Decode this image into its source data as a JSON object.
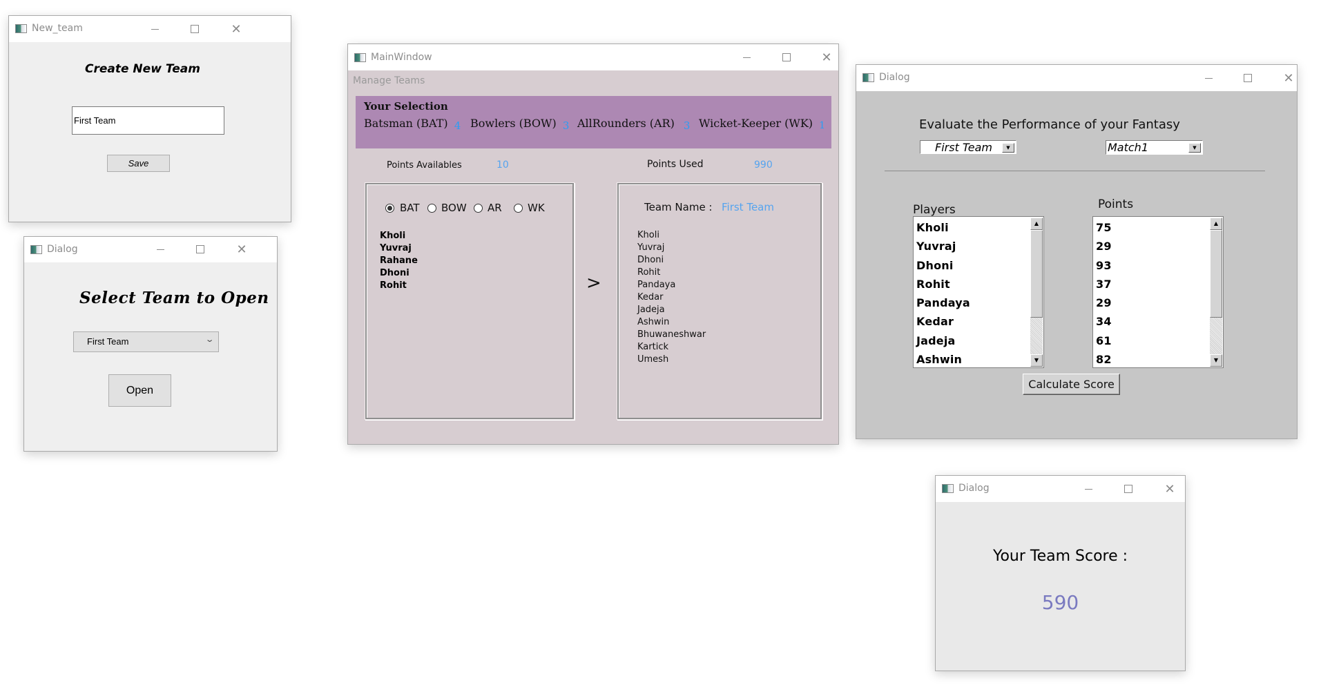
{
  "windows": {
    "new_team": {
      "title": "New_team",
      "heading": "Create New Team",
      "team_name_value": "First Team",
      "save_label": "Save"
    },
    "open_team": {
      "title": "Dialog",
      "heading": "Select Team  to Open",
      "team_select_value": "First Team",
      "open_label": "Open"
    },
    "main": {
      "title": "MainWindow",
      "menu": [
        "Manage Teams"
      ],
      "selection": {
        "heading": "Your Selection",
        "categories": [
          {
            "label": "Batsman (BAT)",
            "count": "4"
          },
          {
            "label": "Bowlers (BOW)",
            "count": "3"
          },
          {
            "label": "AllRounders (AR)",
            "count": "3"
          },
          {
            "label": "Wicket-Keeper (WK)",
            "count": "1"
          }
        ]
      },
      "points_available_label": "Points Availables",
      "points_available_value": "10",
      "points_used_label": "Points Used",
      "points_used_value": "990",
      "roles": [
        {
          "label": "BAT",
          "checked": true
        },
        {
          "label": "BOW",
          "checked": false
        },
        {
          "label": "AR",
          "checked": false
        },
        {
          "label": "WK",
          "checked": false
        }
      ],
      "available_players": [
        "Kholi",
        "Yuvraj",
        "Rahane",
        "Dhoni",
        "Rohit"
      ],
      "move_label": ">",
      "team_name_label": "Team Name  :",
      "team_name_value": "First Team",
      "selected_players": [
        "Kholi",
        "Yuvraj",
        "Dhoni",
        "Rohit",
        "Pandaya",
        "Kedar",
        "Jadeja",
        "Ashwin",
        "Bhuwaneshwar",
        "Kartick",
        "Umesh"
      ]
    },
    "evaluate": {
      "title": "Dialog",
      "heading": "Evaluate the Performance of your Fantasy",
      "team_select_value": "First Team",
      "match_select_value": "Match1",
      "players_label": "Players",
      "points_label": "Points",
      "players": [
        "Kholi",
        "Yuvraj",
        "Dhoni",
        "Rohit",
        "Pandaya",
        "Kedar",
        "Jadeja",
        "Ashwin"
      ],
      "points": [
        "75",
        "29",
        "93",
        "37",
        "29",
        "34",
        "61",
        "82"
      ],
      "calculate_label": "Calculate Score"
    },
    "score": {
      "title": "Dialog",
      "label": "Your Team Score :",
      "value": "590"
    }
  },
  "colors": {
    "accent_blue": "#56a4ef",
    "score_purple": "#7a7ac0",
    "selection_band": "#ad88b3",
    "main_bg": "#d7cdd1",
    "dialog_bg": "#c6c6c6"
  }
}
